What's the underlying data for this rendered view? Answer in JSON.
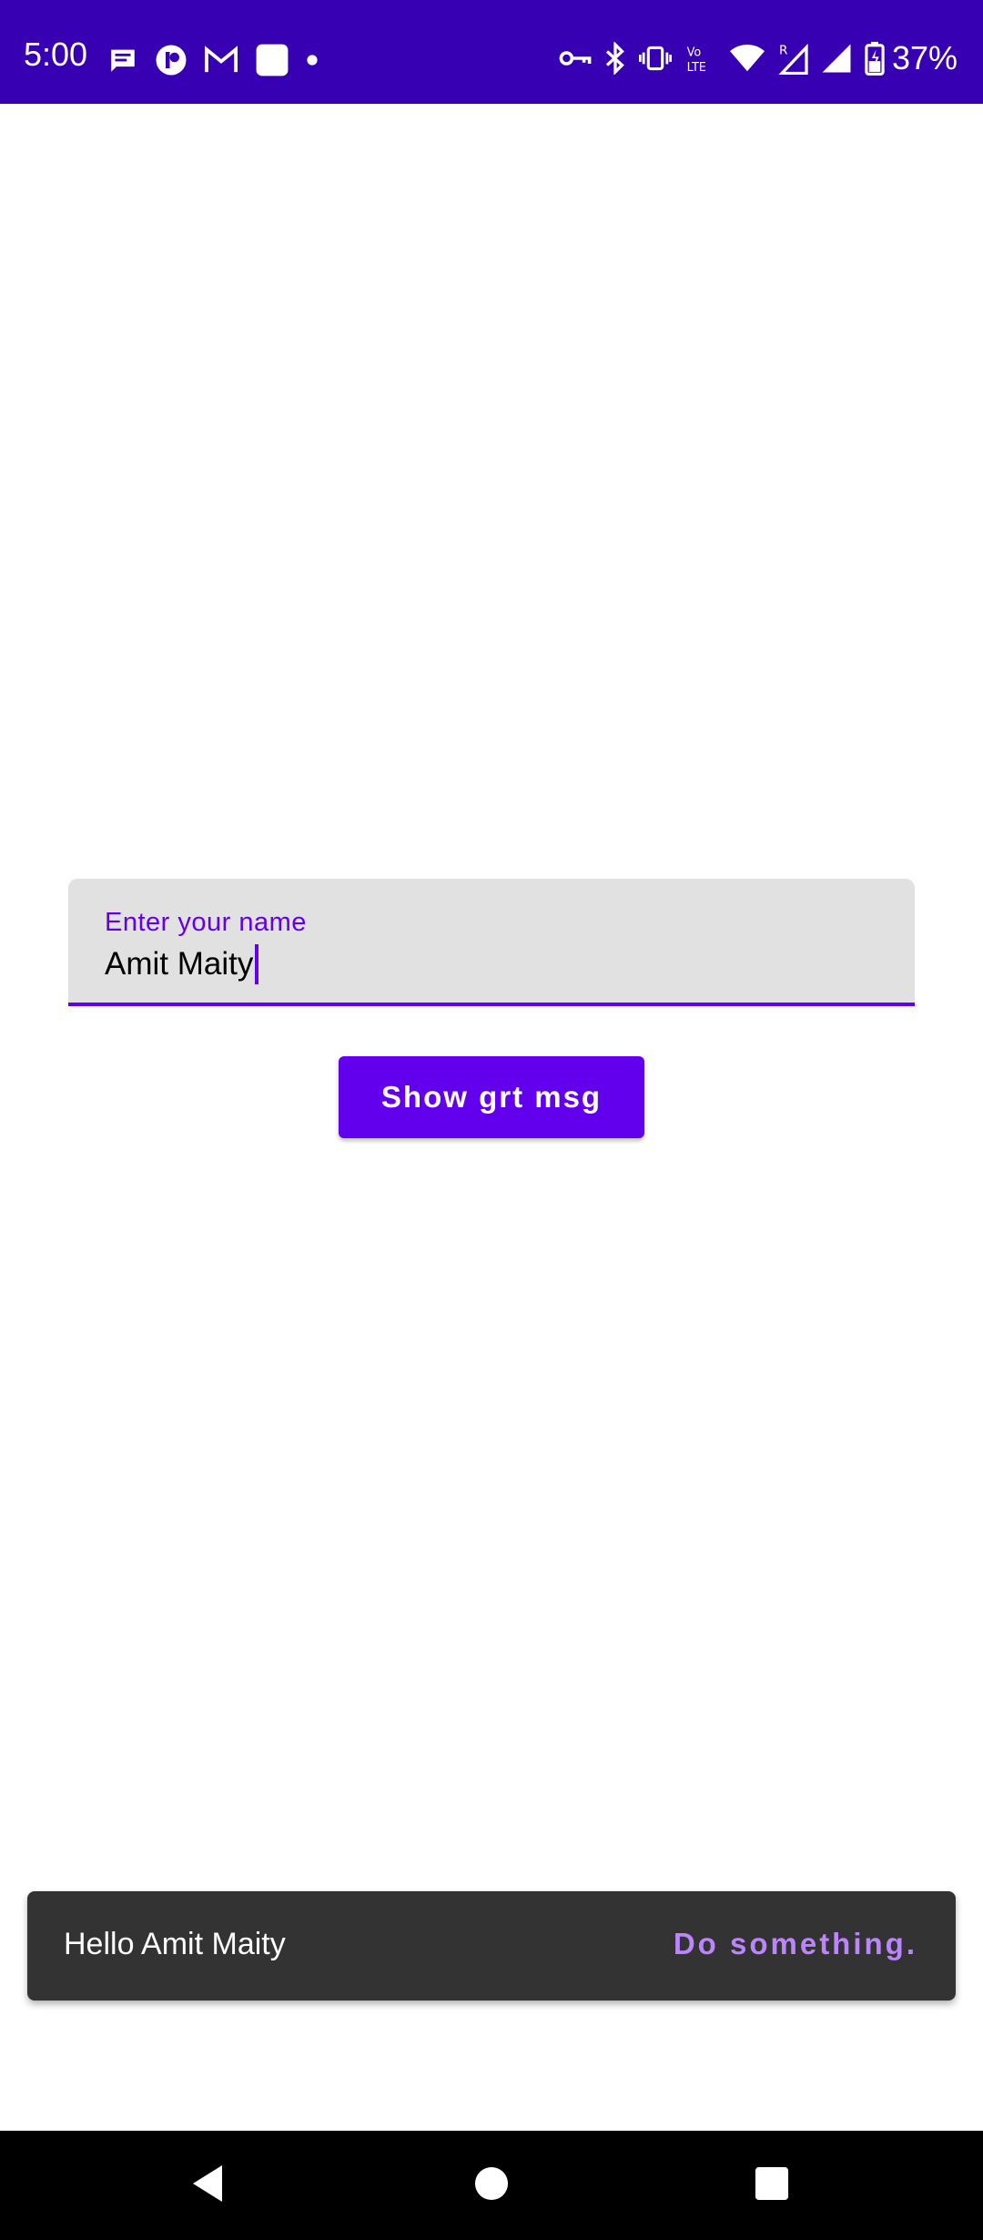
{
  "status_bar": {
    "time": "5:00",
    "battery_percent": "37%",
    "background_color": "#3700B3",
    "left_icons": [
      "message-icon",
      "app-icon",
      "gmail-icon",
      "square-app-icon",
      "dot-icon"
    ],
    "right_icons": [
      "vpn-key-icon",
      "bluetooth-icon",
      "vibrate-icon",
      "volte-icon",
      "wifi-icon",
      "signal-roaming-icon",
      "signal-icon",
      "battery-charging-icon"
    ]
  },
  "name_field": {
    "label": "Enter your name",
    "value": "Amit Maity"
  },
  "primary_button": {
    "label": "Show grt msg"
  },
  "snackbar": {
    "message": "Hello Amit Maity",
    "action_label": "Do something."
  },
  "navigation_bar": {
    "buttons": [
      "back-icon",
      "home-icon",
      "recents-icon"
    ]
  },
  "colors": {
    "primary": "#6200EE",
    "primary_dark": "#3700B3",
    "snackbar_bg": "#333333",
    "snackbar_action": "#BB86FC",
    "field_bg": "#E1E1E1"
  }
}
